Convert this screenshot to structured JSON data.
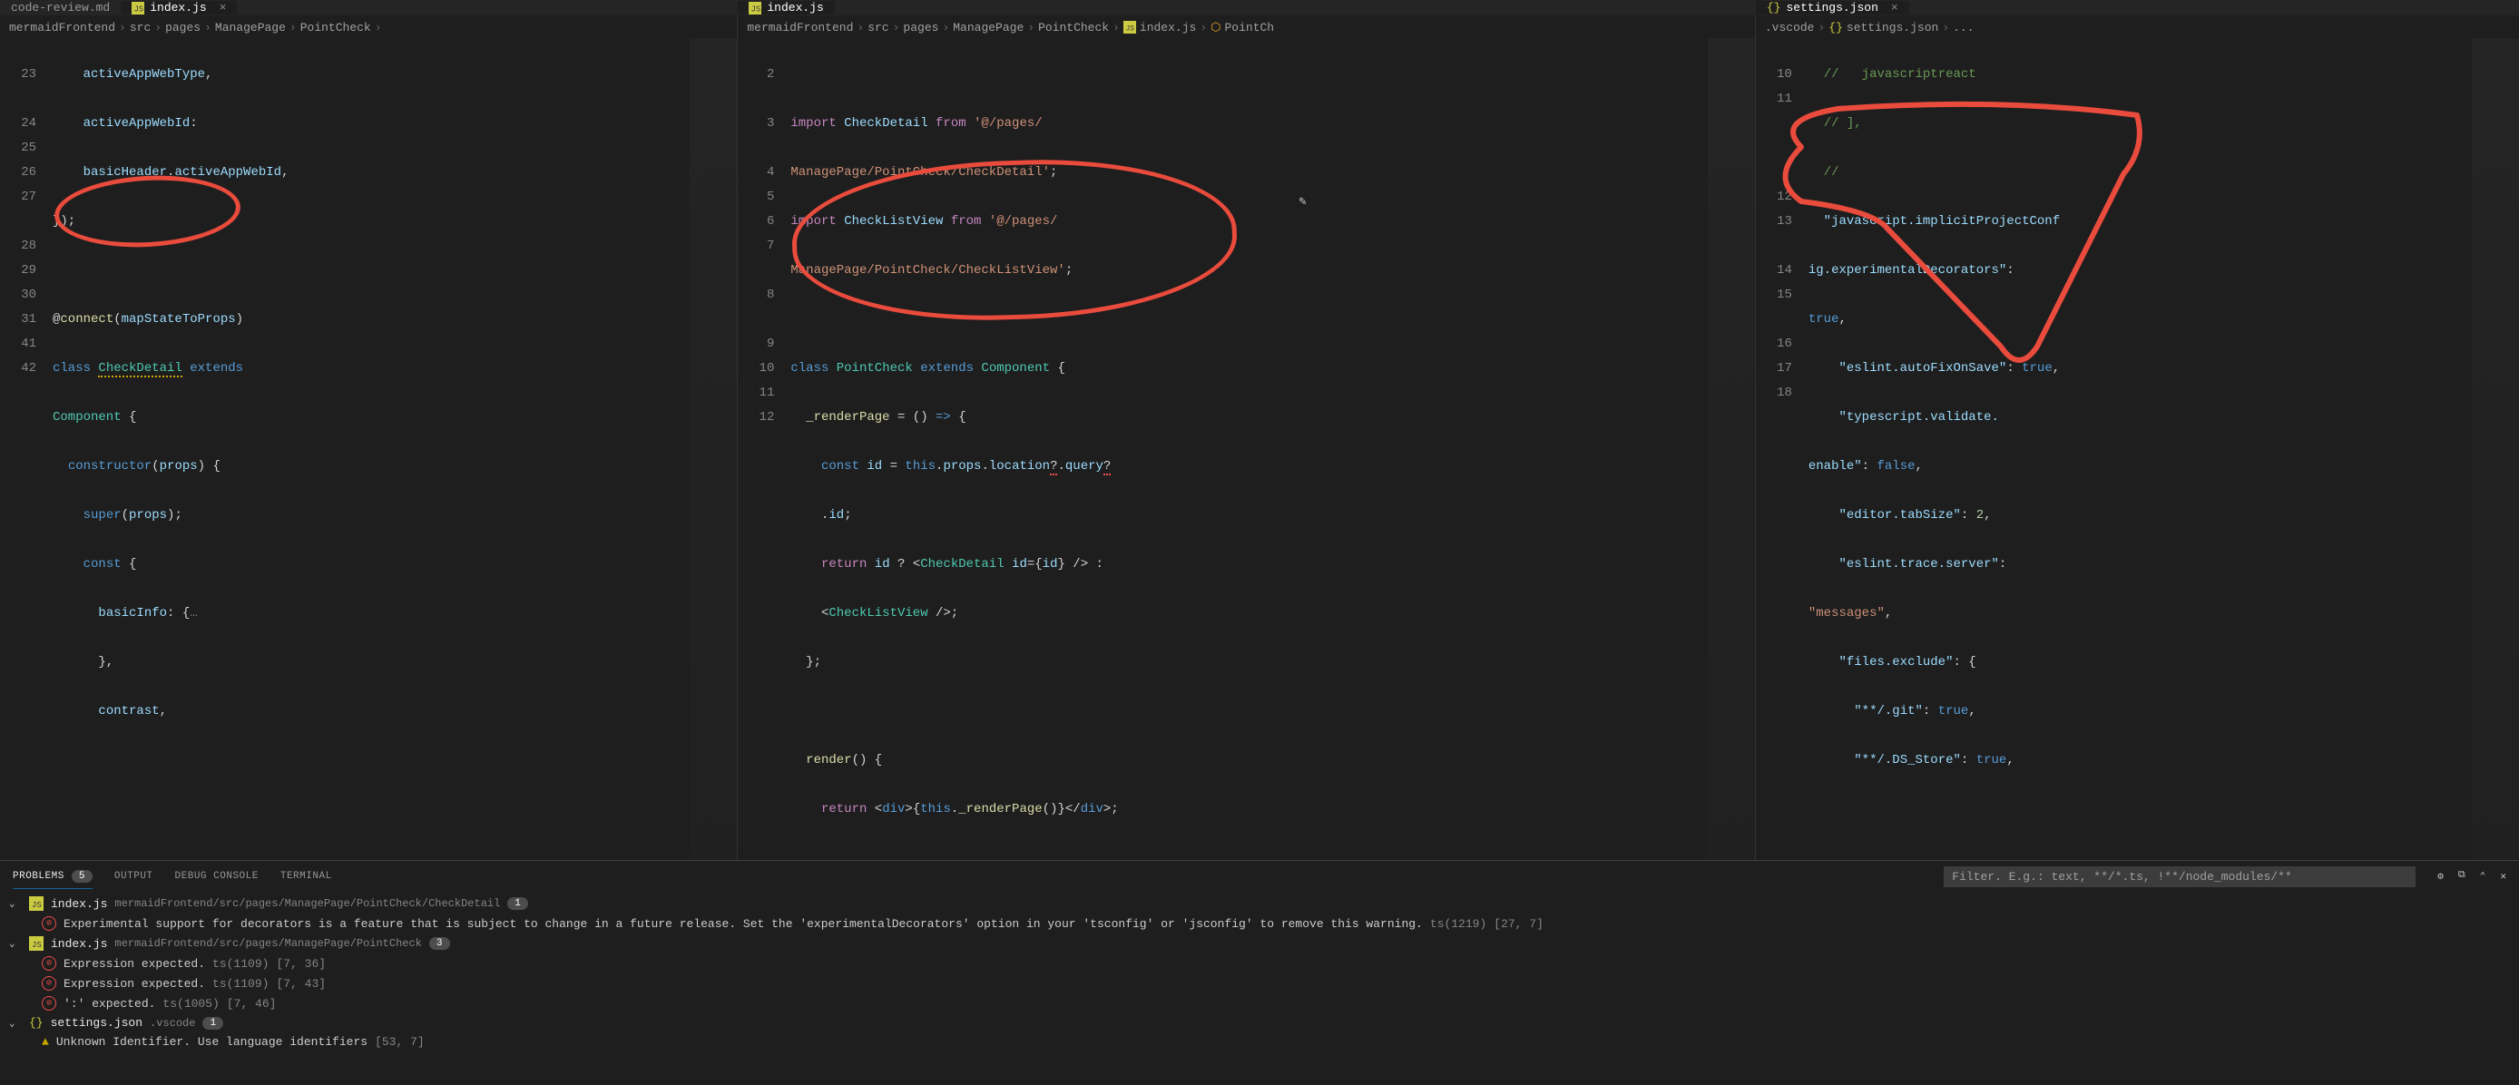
{
  "tabs": {
    "pane1": {
      "label": "index.js",
      "prefix": "code-review.md"
    },
    "pane2": {
      "label": "index.js"
    },
    "pane3": {
      "label": "settings.json"
    }
  },
  "breadcrumbs": {
    "pane1": [
      "mermaidFrontend",
      "src",
      "pages",
      "ManagePage",
      "PointCheck"
    ],
    "pane2": [
      "mermaidFrontend",
      "src",
      "pages",
      "ManagePage",
      "PointCheck",
      "index.js",
      "PointCh"
    ],
    "pane3": [
      ".vscode",
      "settings.json",
      "..."
    ]
  },
  "pane1_lines": {
    "22b": "    activeAppWebType,",
    "23a": "    activeAppWebId:",
    "23b": "    basicHeader.activeAppWebId,",
    "24": "});",
    "25": "",
    "26": "@connect(mapStateToProps)",
    "27a": "class CheckDetail extends",
    "27b": "Component {",
    "28": "  constructor(props) {",
    "29": "    super(props);",
    "30": "    const {",
    "31": "      basicInfo: {…",
    "41": "      },",
    "42": "      contrast,"
  },
  "pane1_nums": [
    "",
    "23",
    "",
    "24",
    "25",
    "26",
    "27",
    "",
    "28",
    "29",
    "30",
    "31",
    "41",
    "42"
  ],
  "pane2_nums": [
    "",
    "2",
    "",
    "3",
    "",
    "4",
    "5",
    "6",
    "7",
    "",
    "8",
    "",
    "9",
    "10",
    "11",
    "12"
  ],
  "pane2_code": {
    "2a": "import CheckDetail from '@/pages/",
    "2b": "ManagePage/PointCheck/CheckDetail';",
    "3a": "import CheckListView from '@/pages/",
    "3b": "ManagePage/PointCheck/CheckListView';",
    "5": "class PointCheck extends Component {",
    "6": "  _renderPage = () => {",
    "7a": "    const id = this.props.location?.query?",
    "7b": "    .id;",
    "8a": "    return id ? <CheckDetail id={id} /> :",
    "8b": "    <CheckListView />;",
    "9": "  };",
    "11": "  render() {",
    "12": "    return <div>{this._renderPage()}</div>;"
  },
  "pane3_nums": [
    "",
    "10",
    "11",
    "",
    "",
    "",
    "12",
    "13",
    "",
    "14",
    "15",
    "",
    "16",
    "17",
    "18"
  ],
  "pane3_code": {
    "9b": "//   javascriptreact",
    "10": "// ],",
    "11": "// ",
    "cfg1": "\"javascript.implicitProjectConfig.experimentalDecorators\":",
    "cfg2": "true,",
    "12": "\"eslint.autoFixOnSave\": true,",
    "13a": "\"typescript.validate.",
    "13b": "enable\": false,",
    "14": "\"editor.tabSize\": 2,",
    "15a": "\"eslint.trace.server\":",
    "15b": "\"messages\",",
    "16": "\"files.exclude\": {",
    "17": "  \"**/.git\": true,",
    "18": "  \"**/.DS_Store\": true,"
  },
  "panel": {
    "tabs": {
      "problems": "PROBLEMS",
      "problems_count": "5",
      "output": "OUTPUT",
      "debug": "DEBUG CONSOLE",
      "terminal": "TERMINAL"
    },
    "filter_placeholder": "Filter. E.g.: text, **/*.ts, !**/node_modules/**"
  },
  "problems": [
    {
      "file": "index.js",
      "path": "mermaidFrontend/src/pages/ManagePage/PointCheck/CheckDetail",
      "count": "1",
      "items": [
        {
          "sev": "error",
          "msg": "Experimental support for decorators is a feature that is subject to change in a future release. Set the 'experimentalDecorators' option in your 'tsconfig' or 'jsconfig' to remove this warning.",
          "src": "ts(1219)",
          "pos": "[27, 7]"
        }
      ]
    },
    {
      "file": "index.js",
      "path": "mermaidFrontend/src/pages/ManagePage/PointCheck",
      "count": "3",
      "items": [
        {
          "sev": "error",
          "msg": "Expression expected.",
          "src": "ts(1109)",
          "pos": "[7, 36]"
        },
        {
          "sev": "error",
          "msg": "Expression expected.",
          "src": "ts(1109)",
          "pos": "[7, 43]"
        },
        {
          "sev": "error",
          "msg": "':' expected.",
          "src": "ts(1005)",
          "pos": "[7, 46]"
        }
      ]
    },
    {
      "file": "settings.json",
      "path": ".vscode",
      "count": "1",
      "items": [
        {
          "sev": "warn",
          "msg": "Unknown Identifier. Use language identifiers",
          "src": "",
          "pos": "[53, 7]"
        }
      ]
    }
  ]
}
